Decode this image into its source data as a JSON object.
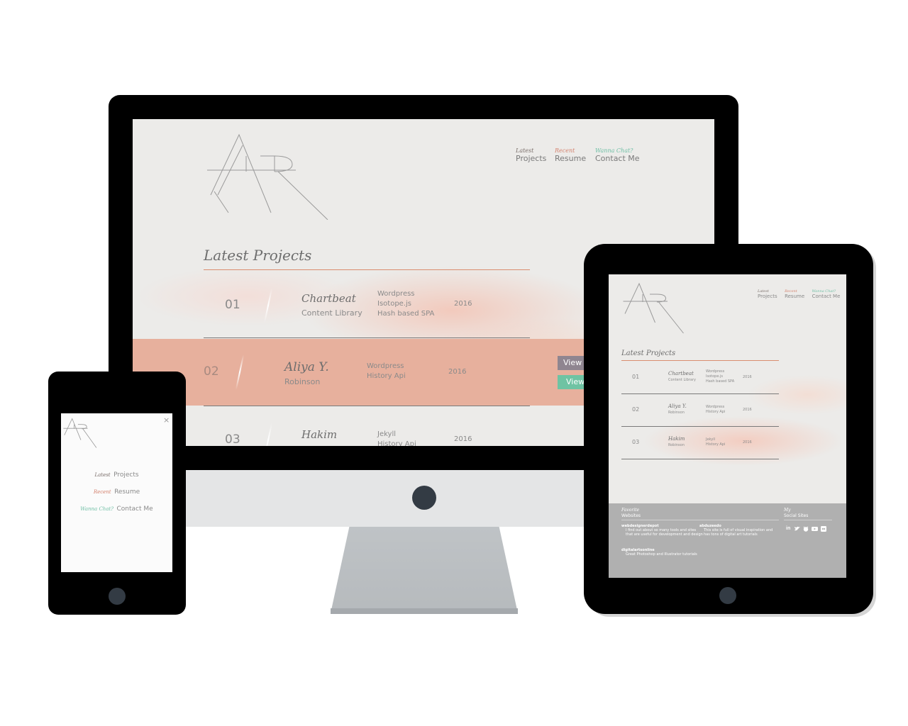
{
  "brand": {
    "logo_text": "ATR"
  },
  "colors": {
    "accent_orange": "#d98d6f",
    "accent_red": "#d4826e",
    "accent_green": "#6fbfa5",
    "button_gray": "#8f8590",
    "button_green": "#6fc3a3",
    "highlight_row": "#e7b09d"
  },
  "nav": [
    {
      "kicker": "Latest",
      "label": "Projects",
      "color": "#7a6e6a"
    },
    {
      "kicker": "Recent",
      "label": "Resume",
      "color": "#d4826e"
    },
    {
      "kicker": "Wanna Chat?",
      "label": "Contact Me",
      "color": "#6fbfa5"
    }
  ],
  "desktop": {
    "section_title": "Latest Projects",
    "projects": [
      {
        "num": "01",
        "name": "Chartbeat",
        "sub": "Content Library",
        "tech": [
          "Wordpress",
          "Isotope.js",
          "Hash based SPA"
        ],
        "year": "2016"
      },
      {
        "num": "02",
        "name": "Aliya Y.",
        "sub": "Robinson",
        "tech": [
          "Wordpress",
          "History Api"
        ],
        "year": "2016"
      },
      {
        "num": "03",
        "name": "Hakim",
        "sub": "",
        "tech": [
          "Jekyll",
          "History Api"
        ],
        "year": "2016"
      }
    ],
    "buttons": {
      "view_project": "View P",
      "view_code": "View C"
    }
  },
  "tablet": {
    "section_title": "Latest Projects",
    "projects": [
      {
        "num": "01",
        "name": "Chartbeat",
        "sub": "Content Library",
        "tech": [
          "Wordpress",
          "Isotope.js",
          "Hash based SPA"
        ],
        "year": "2016"
      },
      {
        "num": "02",
        "name": "Aliya Y.",
        "sub": "Robinson",
        "tech": [
          "Wordpress",
          "History Api"
        ],
        "year": "2016"
      },
      {
        "num": "03",
        "name": "Hakim",
        "sub": "Robinson",
        "tech": [
          "Jekyll",
          "History Api"
        ],
        "year": "2016"
      }
    ],
    "footer": {
      "fav_kicker": "Favorite",
      "fav_title": "Websites",
      "sites": [
        {
          "name": "webdesignerdepot",
          "desc": [
            "I find out about so many tools and sites",
            "that are useful for development and design"
          ]
        },
        {
          "name": "abduzeedo",
          "desc": [
            "This site is full of visual inspiration and",
            "has tons of digital art tutorials"
          ]
        },
        {
          "name": "digitalartsonline",
          "desc": [
            "Great Photoshop and Illustrator tutorials"
          ]
        }
      ],
      "social_kicker": "My",
      "social_title": "Social Sites",
      "social_icons": [
        "linkedin-icon",
        "twitter-icon",
        "github-icon",
        "youtube-icon",
        "flickr-icon"
      ]
    }
  },
  "phone": {
    "close_glyph": "×"
  }
}
